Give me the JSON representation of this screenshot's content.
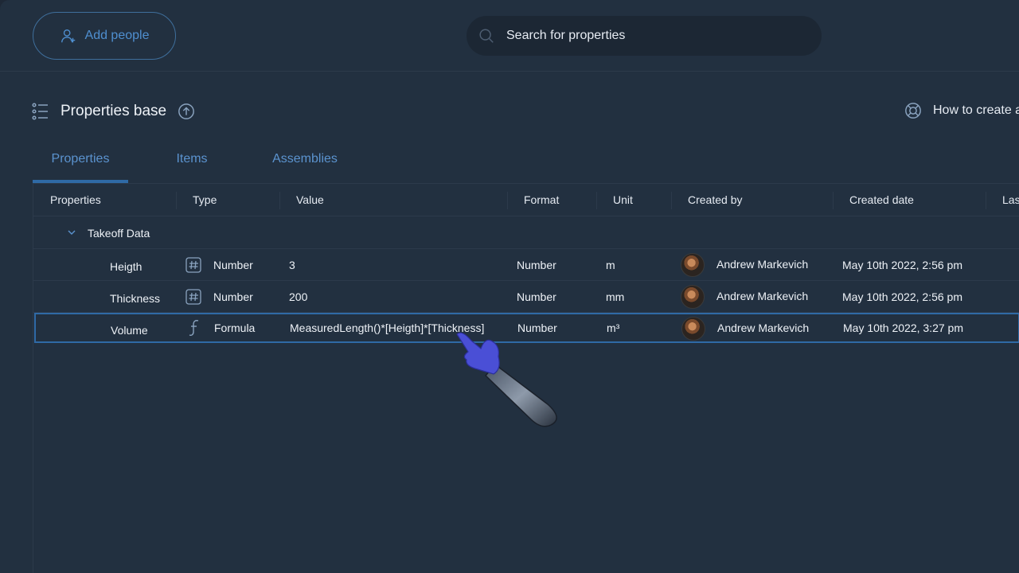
{
  "header": {
    "add_people_label": "Add people",
    "search_placeholder": "Search for properties"
  },
  "page": {
    "title": "Properties base",
    "help_link": "How to create a"
  },
  "tabs": [
    {
      "label": "Properties",
      "active": true
    },
    {
      "label": "Items",
      "active": false
    },
    {
      "label": "Assemblies",
      "active": false
    }
  ],
  "table": {
    "columns": [
      "Properties",
      "Type",
      "Value",
      "Format",
      "Unit",
      "Created by",
      "Created date",
      "Last"
    ],
    "group": {
      "label": "Takeoff Data",
      "expanded": true
    },
    "rows": [
      {
        "name": "Heigth",
        "type_icon": "hash-icon",
        "type": "Number",
        "value": "3",
        "format": "Number",
        "unit": "m",
        "created_by": "Andrew Markevich",
        "created_date": "May 10th 2022, 2:56 pm"
      },
      {
        "name": "Thickness",
        "type_icon": "hash-icon",
        "type": "Number",
        "value": "200",
        "format": "Number",
        "unit": "mm",
        "created_by": "Andrew Markevich",
        "created_date": "May 10th 2022, 2:56 pm"
      },
      {
        "name": "Volume",
        "type_icon": "formula-icon",
        "type": "Formula",
        "value": "MeasuredLength()*[Heigth]*[Thickness]",
        "format": "Number",
        "unit": "m³",
        "created_by": "Andrew Markevich",
        "created_date": "May 10th 2022, 3:27 pm",
        "selected": true
      }
    ]
  },
  "colors": {
    "accent": "#2f6aa6",
    "link": "#5b93cf",
    "background": "#223040"
  }
}
